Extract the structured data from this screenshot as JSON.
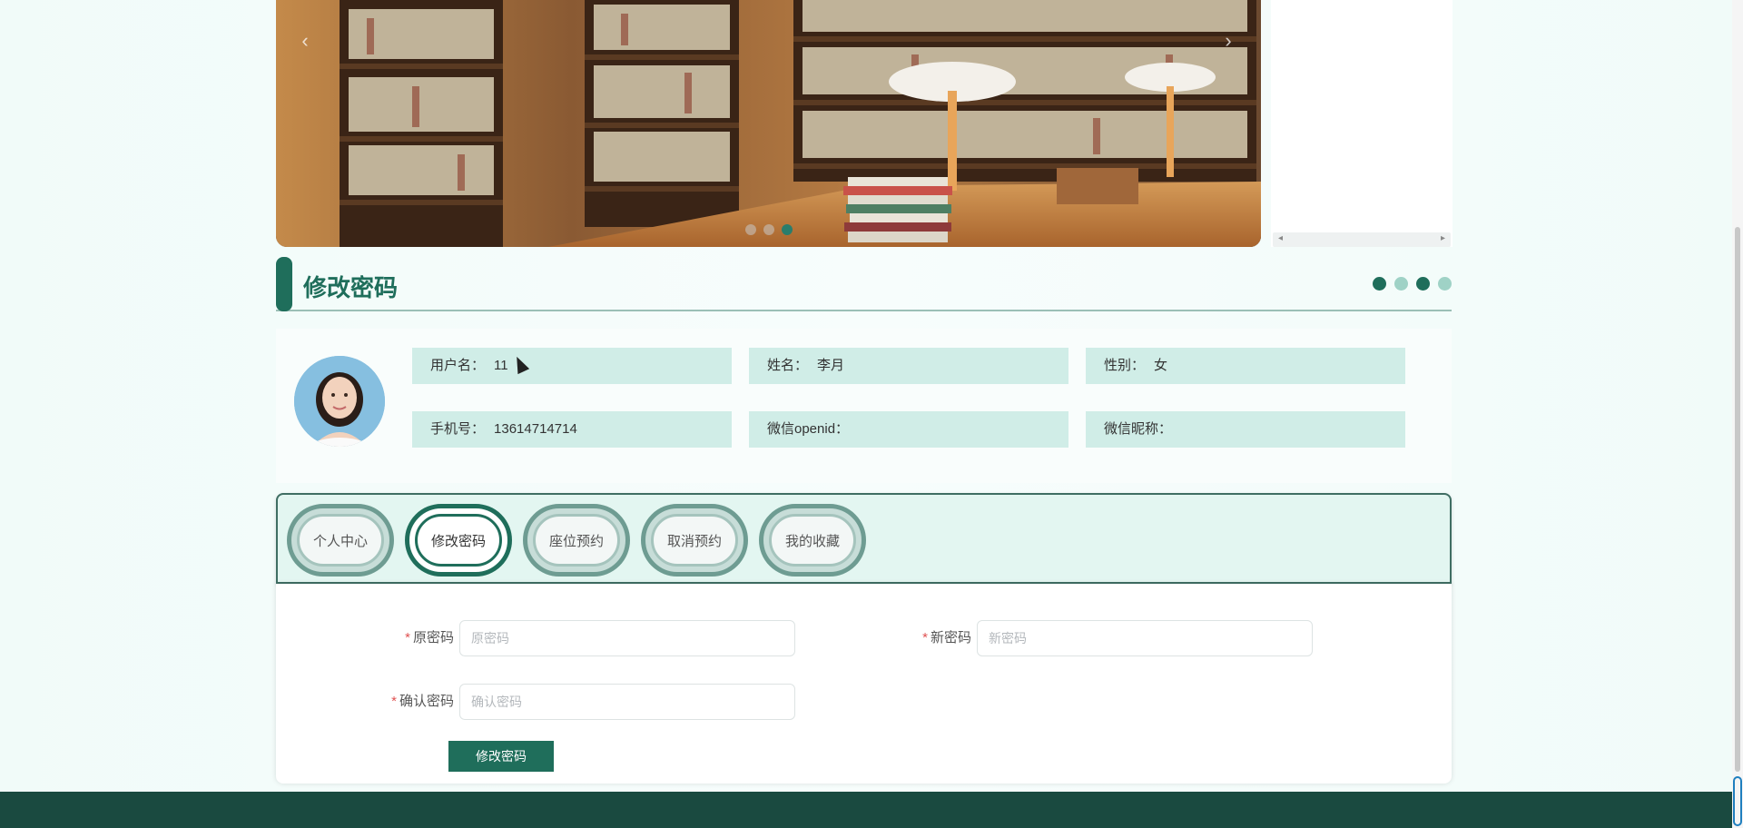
{
  "carousel": {
    "prev_label": "‹",
    "next_label": "›",
    "slide_count": 3,
    "active_slide": 3
  },
  "section": {
    "title": "修改密码",
    "dots_colors": [
      "#1f6e5b",
      "#9fd2c6",
      "#1f6e5b",
      "#9fd2c6"
    ]
  },
  "profile": {
    "username_label": "用户名：",
    "username_value": "11",
    "name_label": "姓名：",
    "name_value": "李月",
    "gender_label": "性别：",
    "gender_value": "女",
    "phone_label": "手机号：",
    "phone_value": "13614714714",
    "openid_label": "微信openid：",
    "openid_value": "",
    "nickname_label": "微信昵称：",
    "nickname_value": ""
  },
  "tabs": [
    {
      "label": "个人中心",
      "active": false
    },
    {
      "label": "修改密码",
      "active": true
    },
    {
      "label": "座位预约",
      "active": false
    },
    {
      "label": "取消预约",
      "active": false
    },
    {
      "label": "我的收藏",
      "active": false
    }
  ],
  "form": {
    "required_mark": "*",
    "old_password_label": "原密码",
    "old_password_placeholder": "原密码",
    "new_password_label": "新密码",
    "new_password_placeholder": "新密码",
    "confirm_password_label": "确认密码",
    "confirm_password_placeholder": "确认密码",
    "submit_label": "修改密码"
  },
  "colors": {
    "accent": "#1f6e5b",
    "light_accent": "#d0ede7",
    "footer": "#1a4a40"
  }
}
